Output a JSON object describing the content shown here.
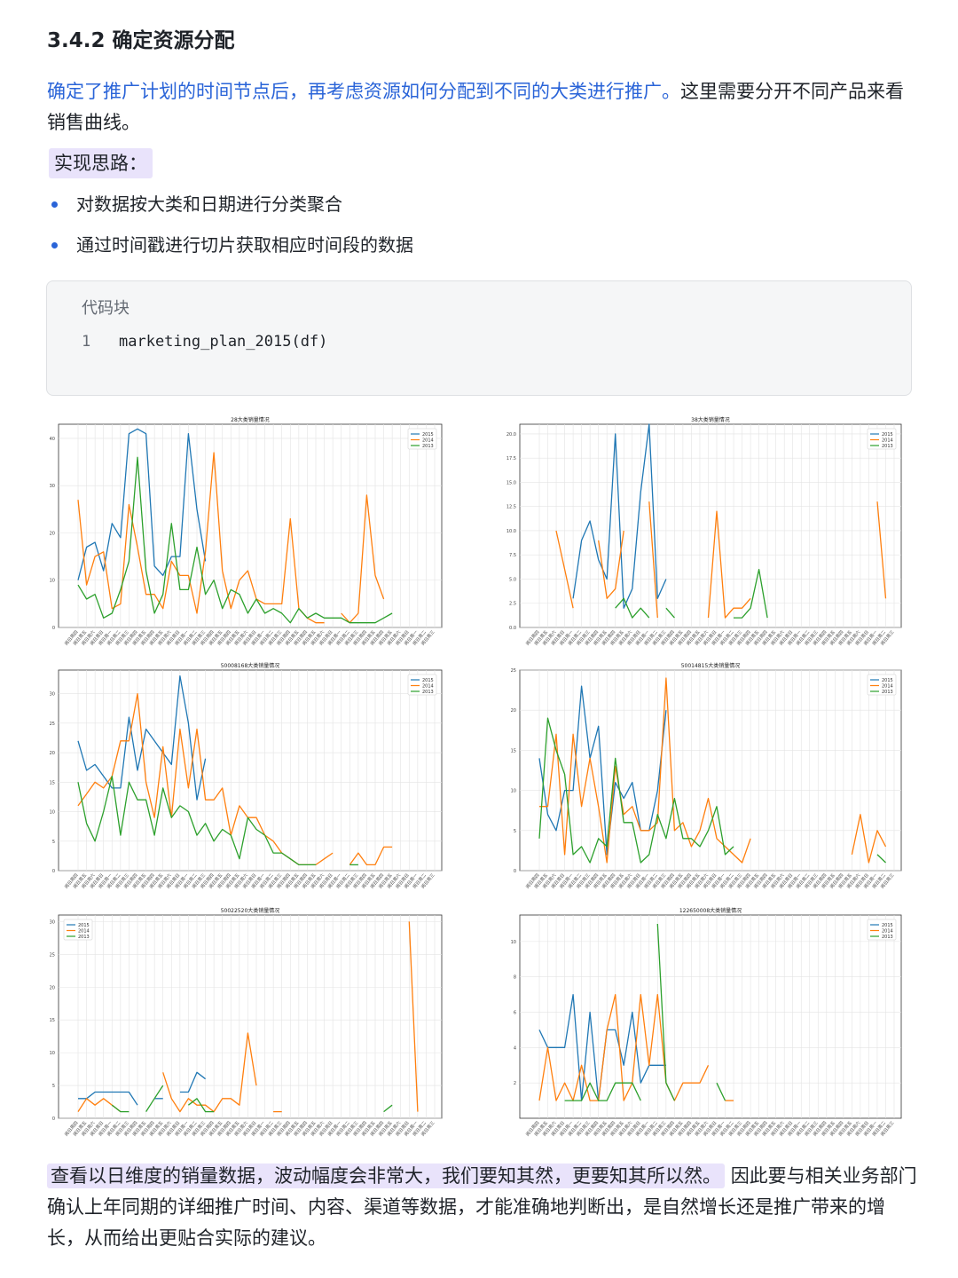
{
  "heading": "3.4.2 确定资源分配",
  "intro": {
    "blue": "确定了推广计划的时间节点后，再考虑资源如何分配到不同的大类进行推广。",
    "rest": "这里需要分开不同产品来看销售曲线。"
  },
  "tag": "实现思路：",
  "bullets": [
    "对数据按大类和日期进行分类聚合",
    "通过时间戳进行切片获取相应时间段的数据"
  ],
  "code": {
    "label": "代码块",
    "line_number": "1",
    "source": "marketing_plan_2015(df)"
  },
  "outro": {
    "highlight": "查看以日维度的销量数据，波动幅度会非常大，我们要知其然，更要知其所以然。",
    "rest": "因此要与相关业务部门确认上年同期的详细推广时间、内容、渠道等数据，才能准确地判断出，是自然增长还是推广带来的增长，从而给出更贴合实际的建议。"
  },
  "colors": {
    "2015": "#1f77b4",
    "2014": "#ff7f0e",
    "2013": "#2ca02c",
    "accent": "#2a64d8",
    "highlight": "#e9e3fb"
  },
  "chart_data": [
    {
      "type": "line",
      "title": "28大类销量情况",
      "legend": "top-right",
      "grid": true,
      "ylim": [
        0,
        43
      ],
      "yticks": [
        0,
        10,
        20,
        30,
        40
      ],
      "series": [
        {
          "name": "2015",
          "values": [
            10,
            17,
            18,
            12,
            22,
            19,
            41,
            42,
            41,
            13,
            11,
            15,
            15,
            41,
            25,
            14
          ]
        },
        {
          "name": "2014",
          "values": [
            27,
            9,
            15,
            16,
            4,
            5,
            26,
            17,
            7,
            7,
            4,
            14,
            11,
            11,
            3,
            16,
            37,
            12,
            4,
            10,
            12,
            6,
            5,
            5,
            5,
            23,
            4,
            2,
            1,
            1,
            null,
            3,
            1,
            3,
            28,
            11,
            6
          ]
        },
        {
          "name": "2013",
          "values": [
            9,
            6,
            7,
            2,
            3,
            8,
            14,
            36,
            12,
            3,
            7,
            22,
            8,
            8,
            17,
            7,
            10,
            4,
            8,
            7,
            3,
            6,
            3,
            4,
            3,
            1,
            4,
            2,
            3,
            2,
            2,
            2,
            1,
            1,
            1,
            1,
            2,
            3
          ]
        }
      ]
    },
    {
      "type": "line",
      "title": "38大类销量情况",
      "legend": "top-right",
      "grid": true,
      "ylim": [
        0,
        21
      ],
      "yticks": [
        0.0,
        2.5,
        5.0,
        7.5,
        10.0,
        12.5,
        15.0,
        17.5,
        20.0
      ],
      "series": [
        {
          "name": "2015",
          "values": [
            null,
            null,
            null,
            null,
            3,
            9,
            11,
            7,
            5,
            20,
            2,
            4,
            14,
            21,
            3,
            5
          ]
        },
        {
          "name": "2014",
          "values": [
            null,
            null,
            10,
            6,
            2,
            null,
            null,
            9,
            3,
            4,
            10,
            null,
            null,
            13,
            1,
            null,
            null,
            null,
            null,
            null,
            1,
            12,
            1,
            2,
            2,
            3,
            null,
            null,
            null,
            null,
            null,
            null,
            null,
            null,
            null,
            null,
            null,
            null,
            null,
            null,
            13,
            3
          ]
        },
        {
          "name": "2013",
          "values": [
            null,
            null,
            null,
            null,
            null,
            null,
            null,
            null,
            null,
            2,
            3,
            1,
            2,
            1,
            null,
            2,
            1,
            null,
            null,
            null,
            null,
            null,
            null,
            1,
            1,
            2,
            6,
            1
          ]
        }
      ]
    },
    {
      "type": "line",
      "title": "50008168大类销量情况",
      "legend": "top-right",
      "grid": true,
      "ylim": [
        0,
        34
      ],
      "yticks": [
        0,
        5,
        10,
        15,
        20,
        25,
        30
      ],
      "series": [
        {
          "name": "2015",
          "values": [
            22,
            17,
            18,
            16,
            14,
            14,
            26,
            17,
            24,
            22,
            20,
            18,
            33,
            25,
            12,
            19
          ]
        },
        {
          "name": "2014",
          "values": [
            11,
            13,
            15,
            14,
            16,
            22,
            22,
            30,
            15,
            9,
            21,
            9,
            24,
            14,
            24,
            12,
            12,
            14,
            6,
            11,
            9,
            9,
            6,
            5,
            3,
            2,
            1,
            1,
            1,
            2,
            3,
            null,
            1,
            3,
            1,
            1,
            4,
            4
          ]
        },
        {
          "name": "2013",
          "values": [
            15,
            8,
            5,
            10,
            16,
            6,
            15,
            12,
            12,
            6,
            14,
            9,
            11,
            10,
            6,
            8,
            5,
            7,
            6,
            2,
            9,
            7,
            6,
            3,
            3,
            2,
            1,
            1,
            1,
            null,
            null,
            null,
            1,
            1
          ]
        }
      ]
    },
    {
      "type": "line",
      "title": "50014815大类销量情况",
      "legend": "top-right",
      "grid": true,
      "ylim": [
        0,
        25
      ],
      "yticks": [
        0,
        5,
        10,
        15,
        20,
        25
      ],
      "series": [
        {
          "name": "2015",
          "values": [
            14,
            7,
            5,
            10,
            10,
            23,
            14,
            18,
            2,
            11,
            9,
            11,
            5,
            5,
            10,
            20
          ]
        },
        {
          "name": "2014",
          "values": [
            8,
            8,
            17,
            2,
            17,
            8,
            14,
            8,
            1,
            13,
            7,
            8,
            5,
            5,
            6,
            24,
            5,
            6,
            3,
            5,
            9,
            4,
            3,
            2,
            1,
            4,
            null,
            null,
            null,
            null,
            null,
            null,
            null,
            null,
            null,
            null,
            null,
            2,
            7,
            1,
            5,
            3
          ]
        },
        {
          "name": "2013",
          "values": [
            4,
            19,
            15,
            12,
            2,
            3,
            1,
            4,
            3,
            14,
            6,
            6,
            1,
            2,
            7,
            4,
            9,
            4,
            4,
            3,
            5,
            8,
            2,
            3,
            null,
            null,
            null,
            null,
            null,
            null,
            null,
            null,
            null,
            null,
            null,
            null,
            null,
            null,
            null,
            null,
            2,
            1
          ]
        }
      ]
    },
    {
      "type": "line",
      "title": "50022520大类销量情况",
      "legend": "top-left",
      "grid": true,
      "ylim": [
        0,
        31
      ],
      "yticks": [
        0,
        5,
        10,
        15,
        20,
        25,
        30
      ],
      "series": [
        {
          "name": "2015",
          "values": [
            3,
            3,
            4,
            4,
            4,
            4,
            4,
            2,
            null,
            3,
            3,
            null,
            4,
            4,
            7,
            6
          ]
        },
        {
          "name": "2014",
          "values": [
            1,
            3,
            2,
            3,
            2,
            1,
            null,
            null,
            null,
            null,
            7,
            3,
            1,
            3,
            2,
            2,
            1,
            3,
            3,
            2,
            13,
            5,
            null,
            1,
            1,
            null,
            null,
            null,
            null,
            null,
            null,
            null,
            null,
            null,
            null,
            null,
            null,
            null,
            null,
            30,
            1
          ]
        },
        {
          "name": "2013",
          "values": [
            null,
            null,
            null,
            null,
            2,
            1,
            1,
            null,
            1,
            3,
            5,
            null,
            null,
            2,
            3,
            1,
            1,
            null,
            null,
            null,
            null,
            null,
            null,
            null,
            null,
            null,
            null,
            null,
            null,
            null,
            null,
            null,
            null,
            null,
            null,
            null,
            1,
            2
          ]
        }
      ]
    },
    {
      "type": "line",
      "title": "122650008大类销量情况",
      "legend": "top-right",
      "grid": true,
      "ylim": [
        0,
        11.5
      ],
      "yticks": [
        2,
        4,
        6,
        8,
        10
      ],
      "series": [
        {
          "name": "2015",
          "values": [
            5,
            4,
            4,
            4,
            7,
            1,
            6,
            1,
            5,
            5,
            3,
            6,
            2,
            3,
            3,
            3
          ]
        },
        {
          "name": "2014",
          "values": [
            1,
            4,
            1,
            2,
            1,
            3,
            1,
            1,
            5,
            7,
            1,
            2,
            7,
            3,
            7,
            2,
            1,
            2,
            2,
            2,
            3,
            null,
            1,
            1
          ]
        },
        {
          "name": "2013",
          "values": [
            null,
            null,
            null,
            1,
            1,
            1,
            2,
            1,
            1,
            2,
            2,
            2,
            1,
            null,
            11,
            2,
            1,
            null,
            null,
            null,
            null,
            2,
            1
          ]
        }
      ]
    }
  ]
}
